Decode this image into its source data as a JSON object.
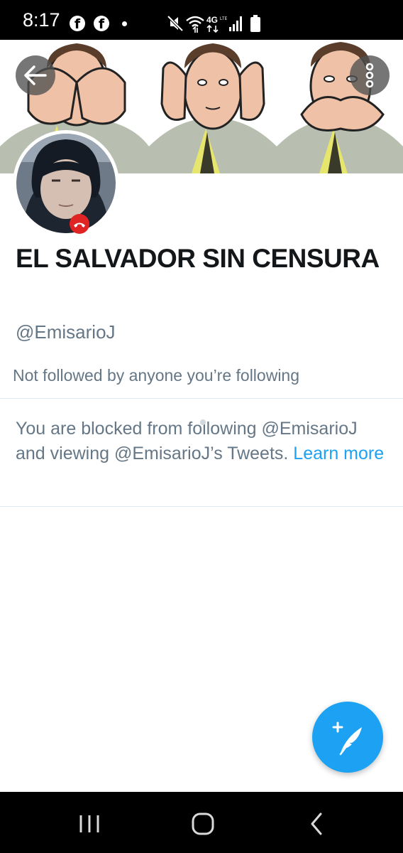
{
  "status_bar": {
    "time": "8:17",
    "notification_icons": [
      "facebook-icon",
      "facebook-icon",
      "dot-icon"
    ],
    "system_icons": [
      "mute-icon",
      "wifi-icon",
      "4g-lte-icon",
      "signal-icon",
      "battery-icon"
    ],
    "network_label": "4G"
  },
  "header": {
    "back_icon": "back-arrow-icon",
    "more_icon": "more-vertical-icon",
    "banner": "three-wise-men-illustration"
  },
  "profile": {
    "name": "EL SALVADOR SIN CENSURA",
    "handle": "@EmisarioJ",
    "followers_note": "Not followed by anyone you’re following"
  },
  "blocked_notice": {
    "text": "You are blocked from following @EmisarioJ and viewing @EmisarioJ’s Tweets.",
    "link": "Learn more"
  },
  "fab": {
    "icon": "compose-tweet-icon"
  },
  "nav_bar": {
    "items": [
      "recents-icon",
      "home-icon",
      "back-icon"
    ]
  },
  "colors": {
    "accent": "#1da1f2",
    "text_primary": "#14171a",
    "text_secondary": "#657786",
    "divider": "#e1e8ed",
    "call_badge": "#e02424"
  }
}
